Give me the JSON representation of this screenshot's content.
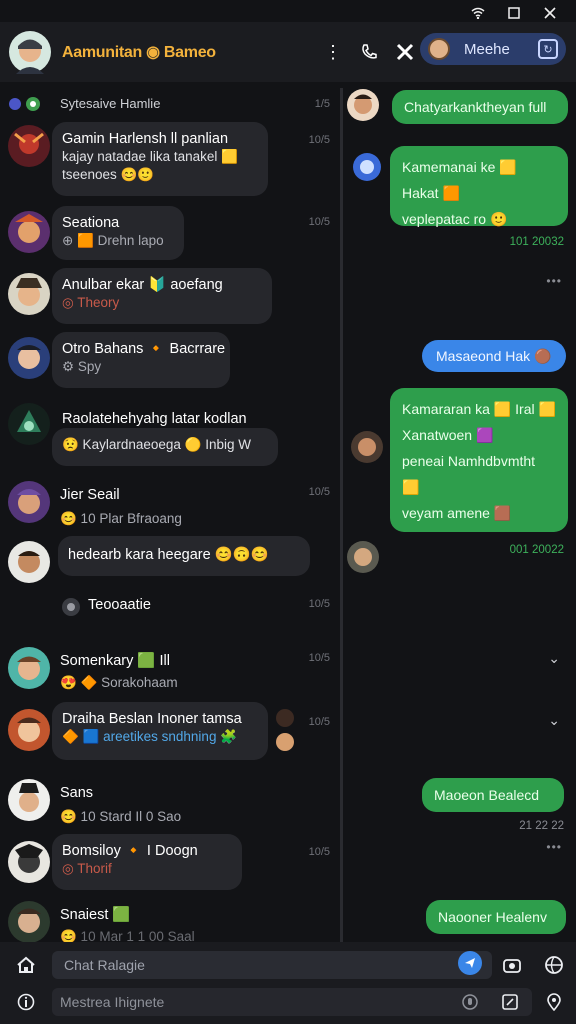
{
  "window": {
    "min_icon": "minimize-icon",
    "max_icon": "maximize-icon",
    "close_icon": "close-icon"
  },
  "header": {
    "title": "Aamunitan ◉ Bameo",
    "title_color": "#f3b23c",
    "profile_pill_label": "Meehe",
    "icons": [
      "more-icon",
      "phone-icon",
      "tools-icon"
    ]
  },
  "chats": [
    {
      "name": "Sytesaive  Hamlie",
      "sub": "",
      "time": "1/5"
    },
    {
      "name": "Gamin Harlensh ll panlian",
      "sub": "kajay natadae lika tanakel 🟨",
      "sub2": "tseenoes 😊🙂",
      "time": "10/5"
    },
    {
      "name": "Seationa",
      "sub": "⊕ 🟧 Drehn lapo",
      "time": "10/5"
    },
    {
      "name": "Anulbar ekar 🔰 aoefang",
      "sub": "◎ Theory",
      "time": ""
    },
    {
      "name": "Otro Bahans 🔸 Bacrrare",
      "sub": "⚙ Spy",
      "time": ""
    },
    {
      "name": "Raolatehehyahg latar kodlan",
      "sub": "😟 Kaylardnaeoega 🟡 Inbig W",
      "time": ""
    },
    {
      "name": "Jier Seail",
      "sub": "😊 10 Plar Bfraoang",
      "time": "10/5"
    },
    {
      "name": "hedearb kara heegare 😊🙃😊",
      "sub": "",
      "time": ""
    },
    {
      "name": "Teooaatie",
      "sub": "",
      "time": "10/5"
    },
    {
      "name": "Somenkary 🟩 Ill",
      "sub": "😍 🔶 Sorakohaam",
      "time": "10/5"
    },
    {
      "name": "Draiha Beslan Inoner tamsa",
      "sub": "🔶 🟦 areetikes sndhning 🧩",
      "time": "10/5"
    },
    {
      "name": "Sans",
      "sub": "😊 10 Stard Il 0 Sao",
      "time": ""
    },
    {
      "name": "Bomsiloy 🔸 I Doogn",
      "sub": "◎ Thorif",
      "time": "10/5"
    },
    {
      "name": "Snaiest 🟩",
      "sub": "😊 10 Mar 1 1 00 Saal",
      "time": ""
    }
  ],
  "messages": [
    {
      "text": "Chatyarkanktheyan full",
      "type": "green"
    },
    {
      "text": "Kamemanai ke 🟨 Hakat 🟧",
      "text2": "veplepatac ro 🙂",
      "type": "green",
      "stamp": "101 20032"
    },
    {
      "text": "Masaeond Hak 🟤",
      "type": "blue"
    },
    {
      "text": "Kamararan ka 🟨 Iral 🟨",
      "text2": "Xanatwoen 🟪",
      "text3": "peneai Namhdbvmtht 🟨",
      "text4": "veyam amene 🟫",
      "type": "green",
      "stamp": "001 20022"
    },
    {
      "text": "Maoeon Bealecd",
      "type": "green",
      "stamp": "21 22 22"
    },
    {
      "text": "Naooner Healenv",
      "type": "green"
    }
  ],
  "bottom": {
    "chat_placeholder": "Chat Ralagie",
    "search_placeholder": "Mestrea Ihignete"
  }
}
